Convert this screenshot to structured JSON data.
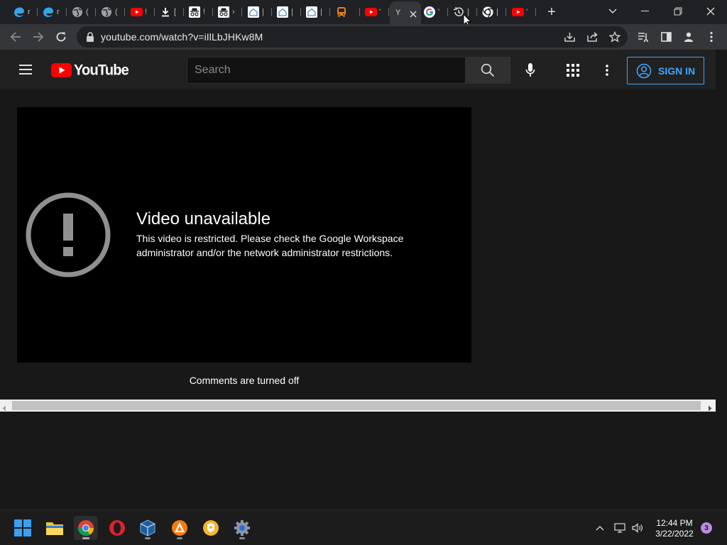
{
  "browser": {
    "tabs": [
      {
        "letter": "r",
        "icon": "edge-logo-icon"
      },
      {
        "letter": "r",
        "icon": "edge-logo-icon"
      },
      {
        "letter": "(",
        "icon": "globe-icon"
      },
      {
        "letter": "(",
        "icon": "globe-icon"
      },
      {
        "letter": "!",
        "icon": "youtube-favicon-icon"
      },
      {
        "letter": "[",
        "icon": "download-icon"
      },
      {
        "letter": "!",
        "icon": "incognito-icon"
      },
      {
        "letter": "›",
        "icon": "incognito-icon"
      },
      {
        "letter": "|",
        "icon": "house-icon"
      },
      {
        "letter": "|",
        "icon": "house-icon"
      },
      {
        "letter": "|",
        "icon": "house-icon"
      },
      {
        "letter": "",
        "icon": "bus-icon"
      },
      {
        "letter": "'",
        "icon": "youtube-favicon-icon"
      },
      {
        "letter": "Y",
        "icon": "none",
        "active": true
      },
      {
        "letter": "'",
        "icon": "google-g-icon"
      },
      {
        "letter": "|",
        "icon": "history-clock-icon"
      },
      {
        "letter": "|",
        "icon": "chrome-logo-icon"
      },
      {
        "letter": "'",
        "icon": "youtube-favicon-icon"
      }
    ],
    "new_tab_label": "+",
    "url": "youtube.com/watch?v=iIlLbJHKw8M"
  },
  "youtube": {
    "logo_text": "YouTube",
    "search_placeholder": "Search",
    "sign_in_label": "SIGN IN",
    "error_title": "Video unavailable",
    "error_message": "This video is restricted. Please check the Google Workspace administrator and/or the network administrator restrictions.",
    "comments_off": "Comments are turned off"
  },
  "taskbar": {
    "time": "12:44 PM",
    "date": "3/22/2022",
    "notification_count": "3"
  },
  "colors": {
    "accent_blue": "#3ea6ff",
    "youtube_red": "#ff0000",
    "player_bg": "#000000",
    "page_bg": "#181818"
  }
}
